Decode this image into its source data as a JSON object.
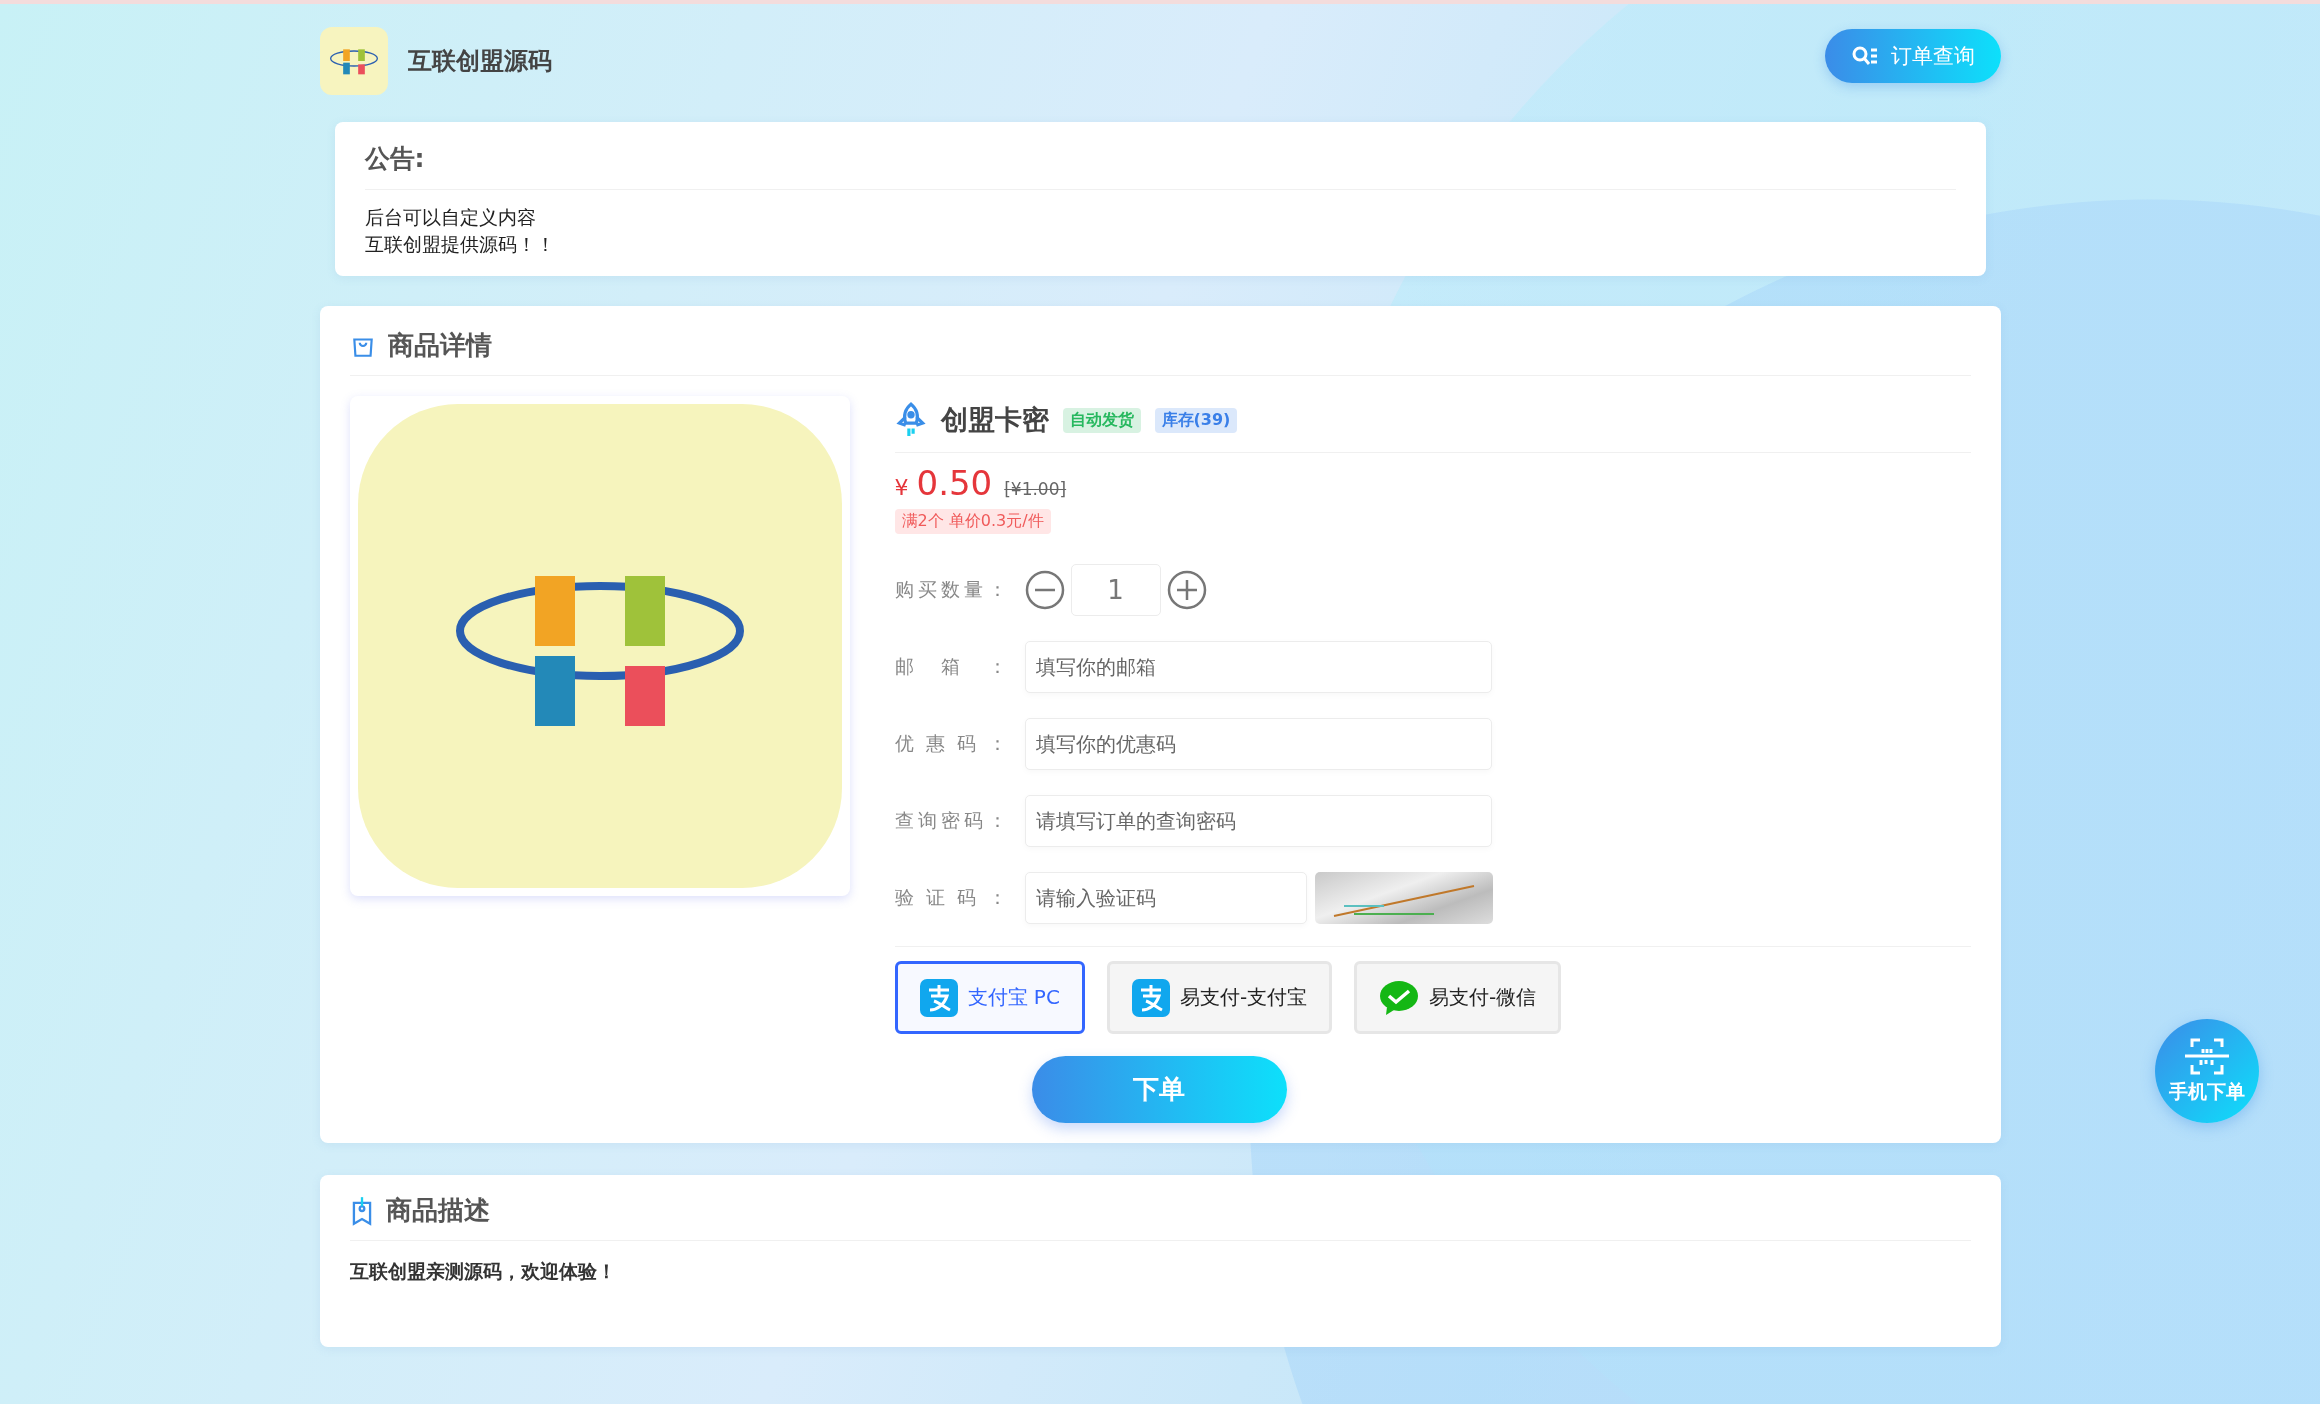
{
  "header": {
    "site_name": "互联创盟源码",
    "order_query_button": "订单查询"
  },
  "notice": {
    "title": "公告:",
    "lines": [
      "后台可以自定义内容",
      "互联创盟提供源码！！"
    ]
  },
  "product": {
    "section_title": "商品详情",
    "name": "创盟卡密",
    "tags": [
      {
        "label": "自动发货",
        "color": "#27b85f"
      },
      {
        "label": "库存(39)",
        "color": "#3a7fe8"
      }
    ],
    "currency": "¥",
    "price": "0.50",
    "original_price": "[¥1.00]",
    "discount": "满2个 单价0.3元/件",
    "quantity": {
      "label": "购买数量：",
      "value": "1"
    },
    "fields": [
      {
        "kind": "text",
        "label": "邮箱：",
        "placeholder": "填写你的邮箱"
      },
      {
        "kind": "text",
        "label": "优惠码：",
        "placeholder": "填写你的优惠码"
      },
      {
        "kind": "text",
        "label": "查询密码：",
        "placeholder": "请填写订单的查询密码"
      },
      {
        "kind": "captcha",
        "label": "验证码：",
        "placeholder": "请输入验证码"
      }
    ],
    "payment_methods": [
      {
        "kind": "alipay",
        "label": "支付宝 PC",
        "selected": true
      },
      {
        "kind": "alipay",
        "label": "易支付-支付宝",
        "selected": false
      },
      {
        "kind": "wechat",
        "label": "易支付-微信",
        "selected": false
      }
    ],
    "submit_button": "下单"
  },
  "description": {
    "section_title": "商品描述",
    "text": "互联创盟亲测源码，欢迎体验！"
  },
  "floating_button": "手机下单"
}
